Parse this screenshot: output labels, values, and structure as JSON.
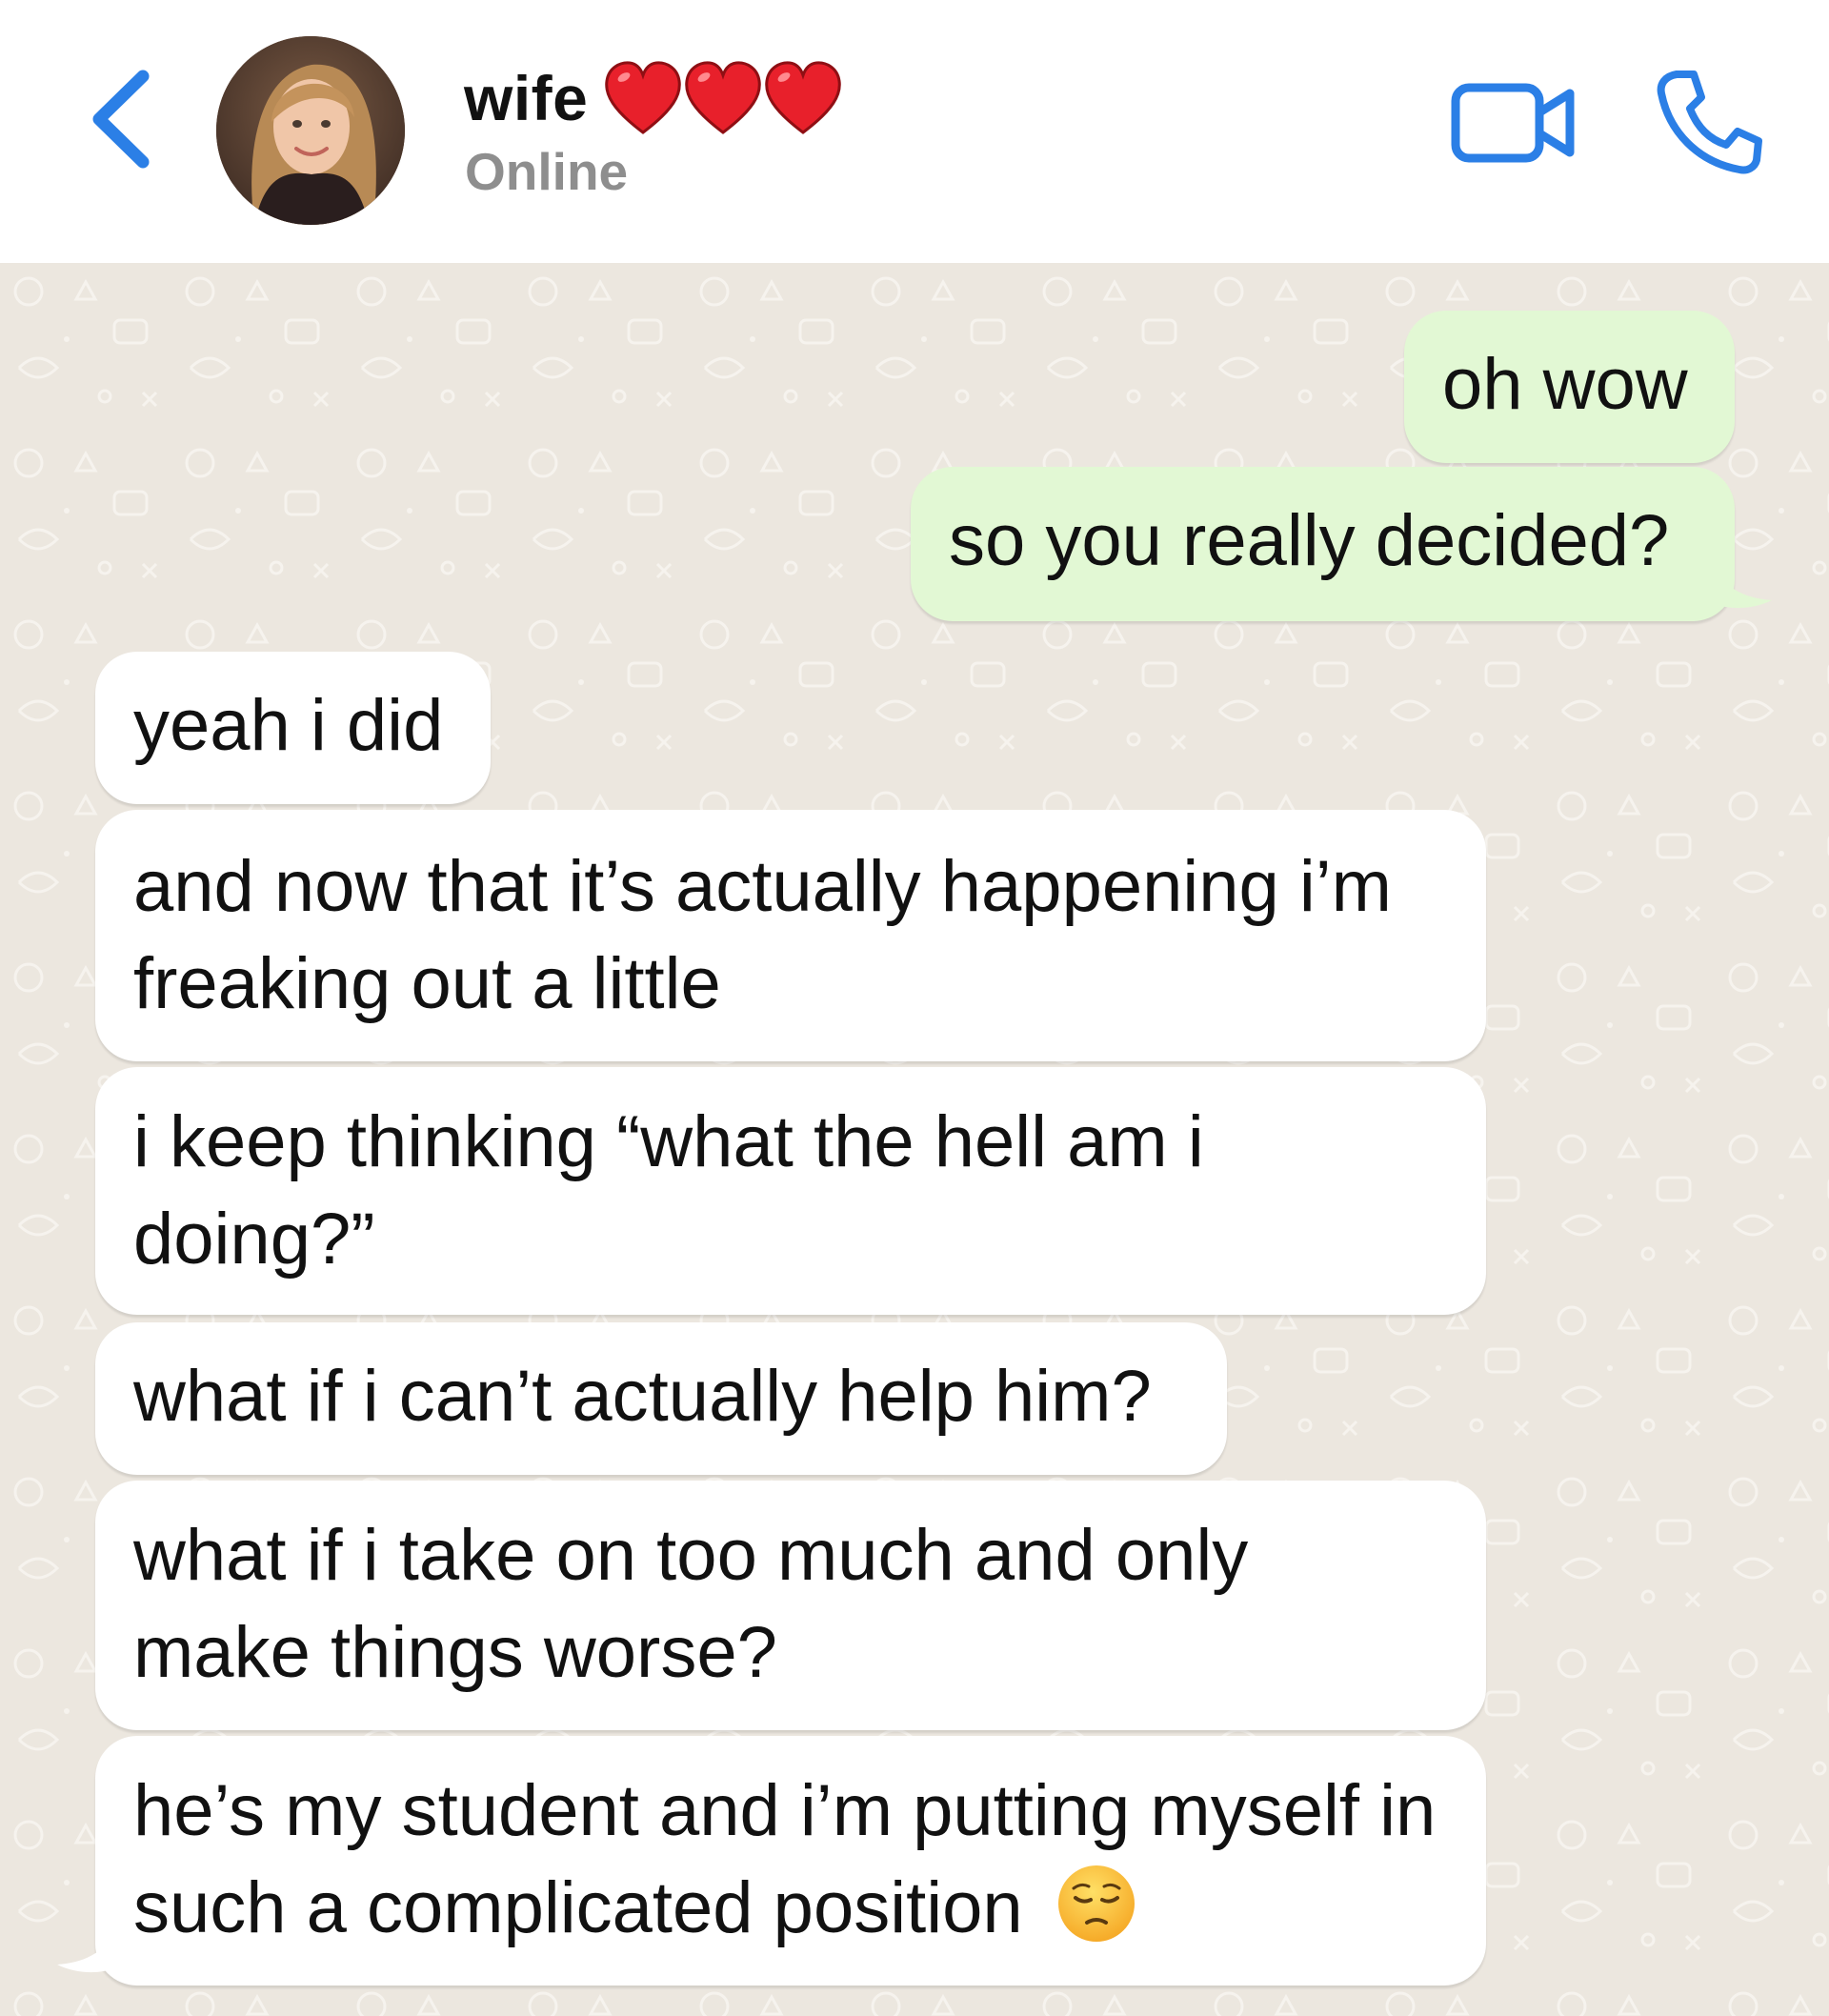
{
  "header": {
    "contact_name": "wife",
    "status": "Online",
    "name_suffix_icons": [
      "heart-icon",
      "heart-icon",
      "heart-icon"
    ],
    "accent_color": "#2b7fe6"
  },
  "messages": [
    {
      "direction": "outgoing",
      "text": "oh wow"
    },
    {
      "direction": "outgoing",
      "text": "so you really decided?"
    },
    {
      "direction": "incoming",
      "text": "yeah i did"
    },
    {
      "direction": "incoming",
      "text": "and now that it’s actually happening i’m freaking out a little"
    },
    {
      "direction": "incoming",
      "text": "i keep thinking “what the hell am i doing?”"
    },
    {
      "direction": "incoming",
      "text": "what if i can’t actually help him?"
    },
    {
      "direction": "incoming",
      "text": "what if i take on too much and only make things worse?"
    },
    {
      "direction": "incoming",
      "text": "he’s my student and i’m putting myself in such a complicated position",
      "trailing_emoji": "pensive-face-emoji"
    }
  ],
  "colors": {
    "outgoing_bubble": "#e2f8d4",
    "incoming_bubble": "#ffffff",
    "chat_background": "#ece7df",
    "status_text": "#8e8e8e"
  }
}
